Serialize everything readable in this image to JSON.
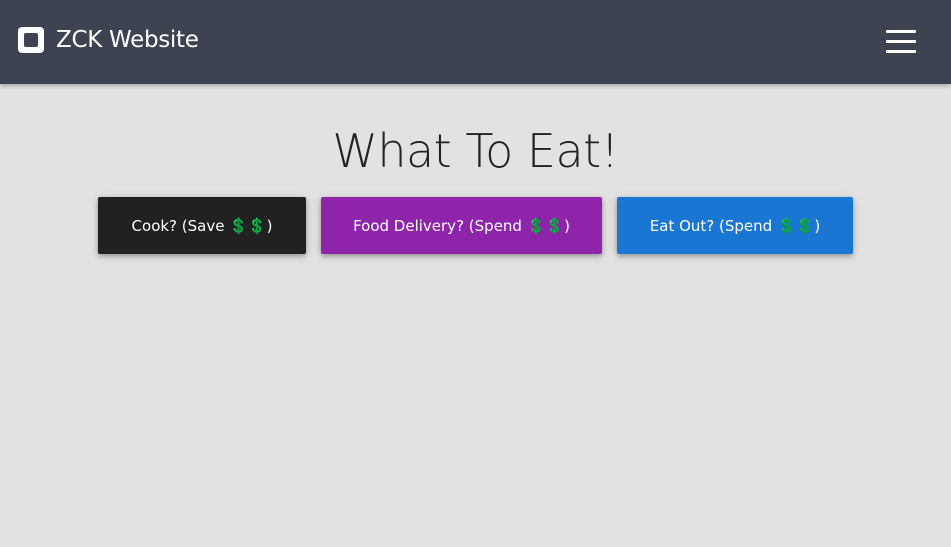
{
  "navbar": {
    "brand_icon": "square-logo-icon",
    "brand_text": "ZCK Website",
    "menu_icon": "hamburger-menu-icon",
    "background_color": "#3d4350"
  },
  "main": {
    "title": "What To Eat!",
    "buttons": [
      {
        "label": "Cook? (Save ",
        "emoji": "💲💲",
        "suffix": ")",
        "color": "#212121"
      },
      {
        "label": "Food Delivery? (Spend ",
        "emoji": "💲💲",
        "suffix": ")",
        "color": "#8e24aa"
      },
      {
        "label": "Eat Out? (Spend ",
        "emoji": "💲💲",
        "suffix": ")",
        "color": "#1976d2"
      }
    ]
  },
  "page": {
    "background_color": "#e2e2e2"
  }
}
